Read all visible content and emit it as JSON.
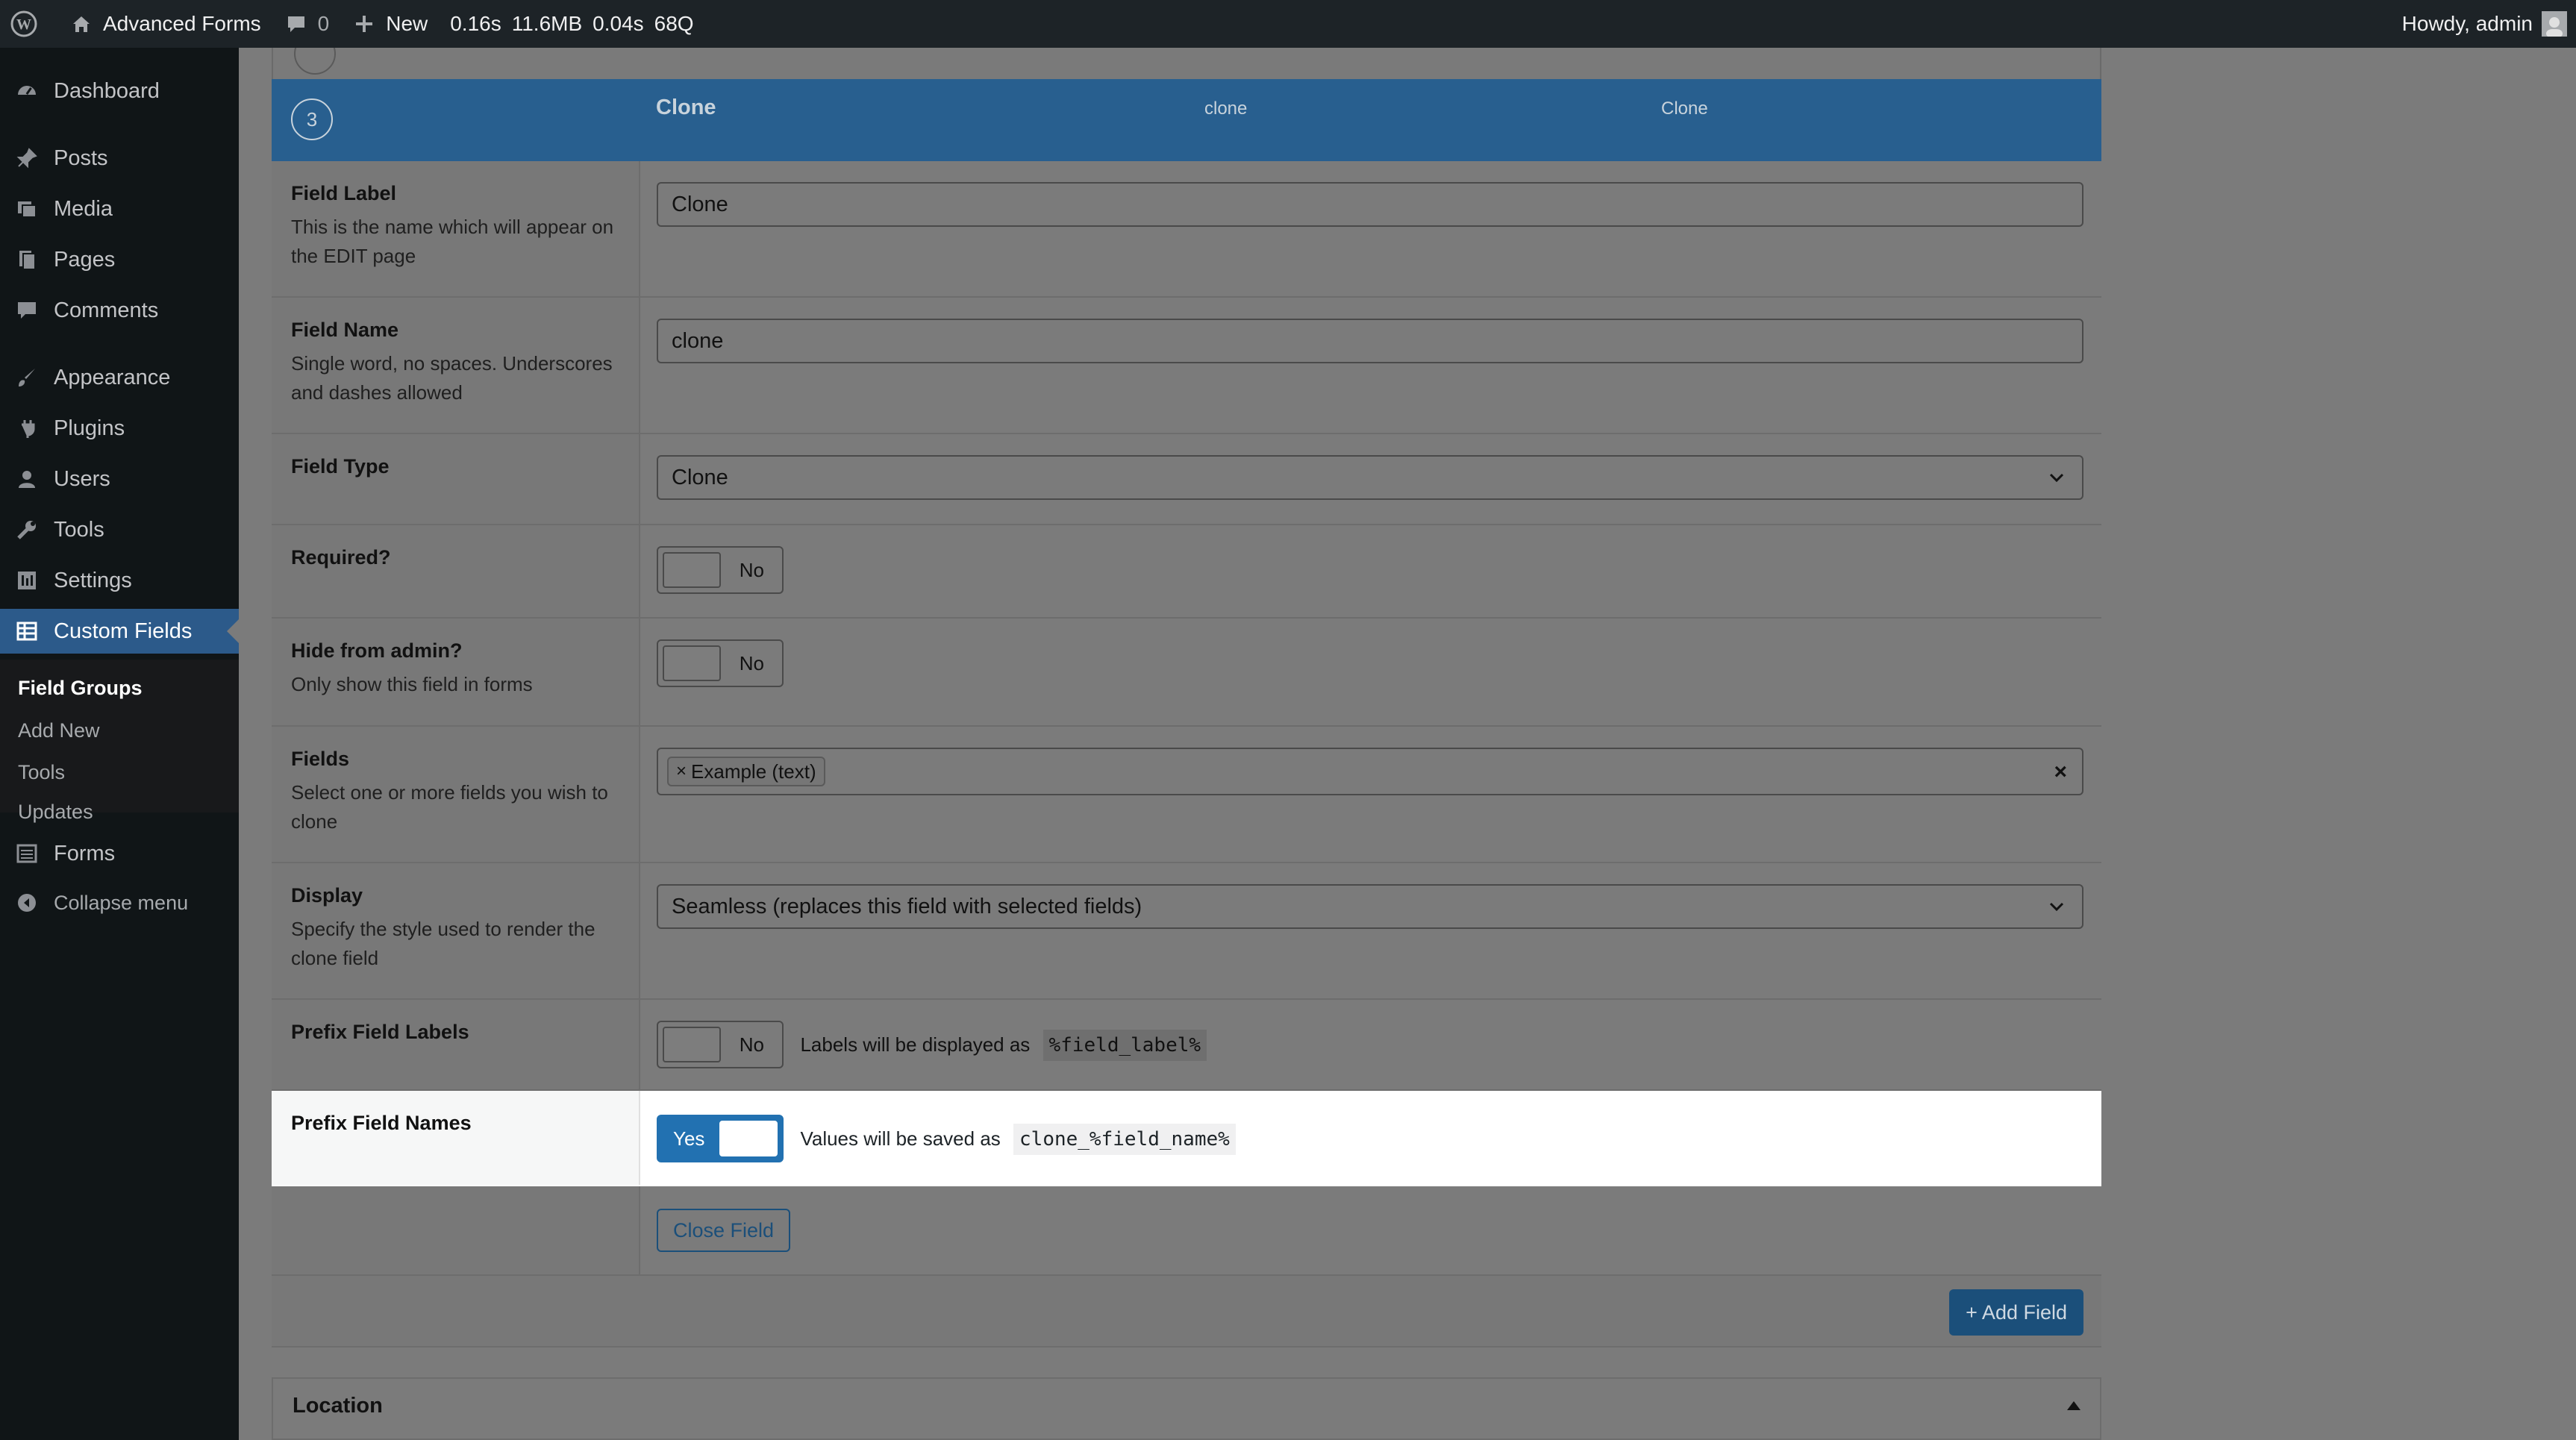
{
  "adminbar": {
    "site_name": "Advanced Forms",
    "comments_count": "0",
    "new_label": "New",
    "stats": [
      "0.16s",
      "11.6MB",
      "0.04s",
      "68Q"
    ],
    "howdy": "Howdy, admin"
  },
  "sidebar": {
    "items": [
      {
        "label": "Dashboard",
        "icon": "dashboard-icon"
      },
      {
        "label": "Posts",
        "icon": "pin-icon"
      },
      {
        "label": "Media",
        "icon": "media-icon"
      },
      {
        "label": "Pages",
        "icon": "pages-icon"
      },
      {
        "label": "Comments",
        "icon": "comment-icon"
      },
      {
        "label": "Appearance",
        "icon": "brush-icon"
      },
      {
        "label": "Plugins",
        "icon": "plug-icon"
      },
      {
        "label": "Users",
        "icon": "user-icon"
      },
      {
        "label": "Tools",
        "icon": "wrench-icon"
      },
      {
        "label": "Settings",
        "icon": "settings-icon"
      },
      {
        "label": "Custom Fields",
        "icon": "table-icon"
      },
      {
        "label": "Forms",
        "icon": "list-icon"
      },
      {
        "label": "Collapse menu",
        "icon": "collapse-icon"
      }
    ],
    "submenu": [
      "Field Groups",
      "Add New",
      "Tools",
      "Updates"
    ]
  },
  "field": {
    "order": "3",
    "header_label": "Clone",
    "header_name": "clone",
    "header_type": "Clone",
    "label": {
      "title": "Field Label",
      "desc": "This is the name which will appear on the EDIT page",
      "value": "Clone"
    },
    "name": {
      "title": "Field Name",
      "desc": "Single word, no spaces. Underscores and dashes allowed",
      "value": "clone"
    },
    "type": {
      "title": "Field Type",
      "value": "Clone"
    },
    "required": {
      "title": "Required?",
      "toggle": "No"
    },
    "hide_admin": {
      "title": "Hide from admin?",
      "desc": "Only show this field in forms",
      "toggle": "No"
    },
    "fields": {
      "title": "Fields",
      "desc": "Select one or more fields you wish to clone",
      "chip": "Example (text)"
    },
    "display": {
      "title": "Display",
      "desc": "Specify the style used to render the clone field",
      "value": "Seamless (replaces this field with selected fields)"
    },
    "prefix_labels": {
      "title": "Prefix Field Labels",
      "toggle": "No",
      "msg": "Labels will be displayed as",
      "code": "%field_label%"
    },
    "prefix_names": {
      "title": "Prefix Field Names",
      "toggle": "Yes",
      "msg": "Values will be saved as",
      "code": "clone_%field_name%"
    },
    "close_button": "Close Field"
  },
  "add_field_button": "+ Add Field",
  "location_title": "Location",
  "colors": {
    "accent": "#2271b1",
    "header": "#285f8f",
    "adminbar": "#1d2327"
  }
}
